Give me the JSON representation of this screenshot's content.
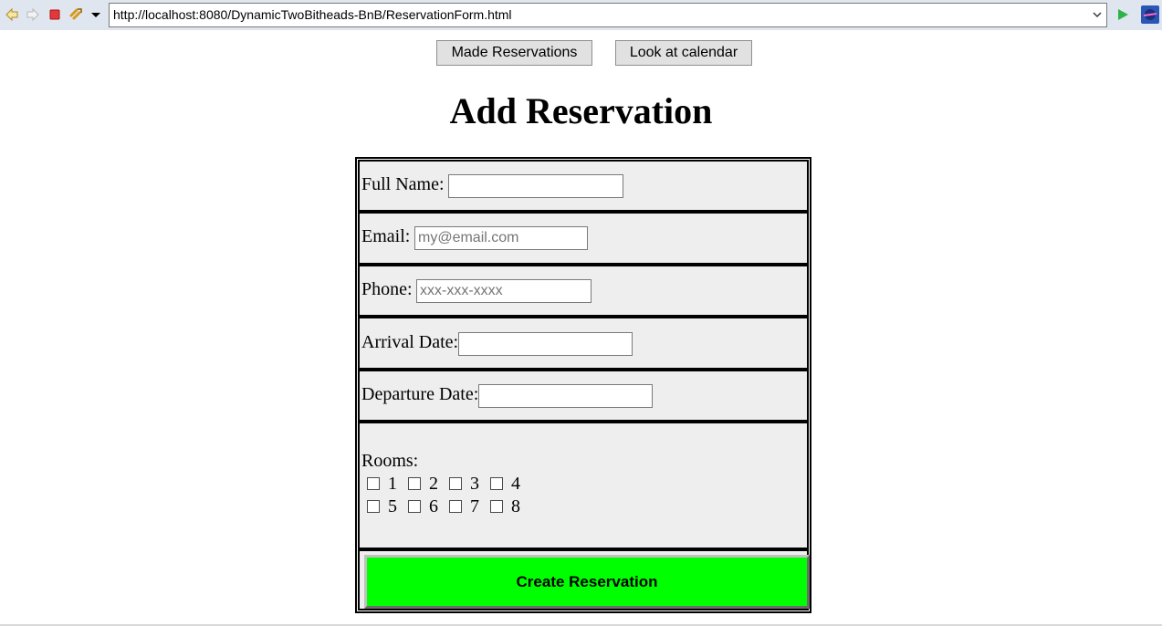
{
  "browser": {
    "url": "http://localhost:8080/DynamicTwoBitheads-BnB/ReservationForm.html"
  },
  "nav": {
    "made_reservations": "Made Reservations",
    "look_at_calendar": "Look at calendar"
  },
  "page": {
    "title": "Add Reservation"
  },
  "form": {
    "full_name": {
      "label": "Full Name:",
      "value": "",
      "placeholder": ""
    },
    "email": {
      "label": "Email:",
      "value": "",
      "placeholder": "my@email.com"
    },
    "phone": {
      "label": "Phone:",
      "value": "",
      "placeholder": "xxx-xxx-xxxx"
    },
    "arrival": {
      "label": "Arrival Date:",
      "value": ""
    },
    "departure": {
      "label": "Departure Date:",
      "value": ""
    },
    "rooms": {
      "label": "Rooms:",
      "options": [
        "1",
        "2",
        "3",
        "4",
        "5",
        "6",
        "7",
        "8"
      ],
      "checked": []
    },
    "submit_label": "Create Reservation"
  },
  "colors": {
    "submit_bg": "#00ff00",
    "row_bg": "#eeeeee",
    "toolbar_bg": "#dfe6ef"
  }
}
